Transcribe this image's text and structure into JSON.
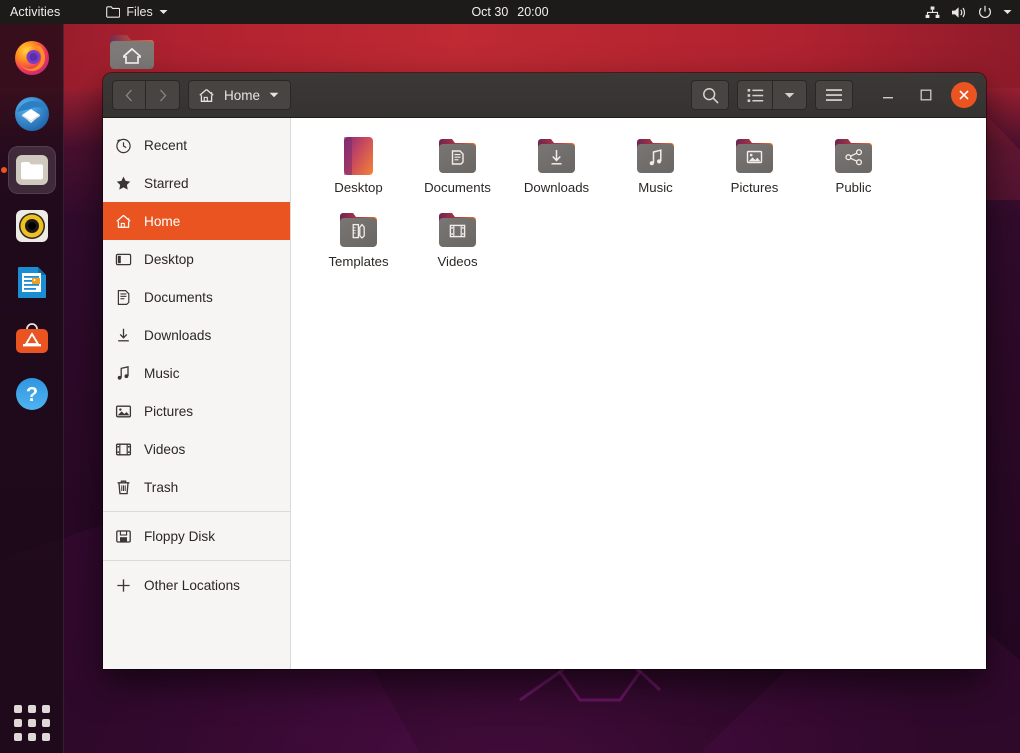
{
  "topbar": {
    "activities": "Activities",
    "app_name": "Files",
    "app_icon": "folder-icon",
    "app_menu_arrow_icon": "chevron-down-icon",
    "clock_date": "Oct 30",
    "clock_time": "20:00",
    "tray_icons": [
      "network-icon",
      "volume-icon",
      "power-icon",
      "chevron-down-icon"
    ]
  },
  "dock": {
    "items": [
      {
        "name": "firefox",
        "label": "Firefox",
        "active": false
      },
      {
        "name": "thunderbird",
        "label": "Thunderbird",
        "active": false
      },
      {
        "name": "files",
        "label": "Files",
        "active": true
      },
      {
        "name": "rhythmbox",
        "label": "Rhythmbox",
        "active": false
      },
      {
        "name": "libreoffice-writer",
        "label": "LibreOffice Writer",
        "active": false
      },
      {
        "name": "ubuntu-software",
        "label": "Ubuntu Software",
        "active": false
      },
      {
        "name": "help",
        "label": "Help",
        "active": false
      }
    ],
    "app_grid_label": "Show Applications"
  },
  "desktop": {
    "home_icon_label": ""
  },
  "window": {
    "header": {
      "back_icon": "chevron-left-icon",
      "forward_icon": "chevron-right-icon",
      "path_icon": "home-icon",
      "path_label": "Home",
      "path_arrow_icon": "chevron-down-icon",
      "search_icon": "search-icon",
      "view_list_icon": "list-view-icon",
      "view_arrow_icon": "chevron-down-icon",
      "menu_icon": "hamburger-menu-icon",
      "minimize_icon": "minimize-icon",
      "maximize_icon": "maximize-icon",
      "close_icon": "close-icon",
      "accent_color": "#e95420"
    },
    "sidebar": {
      "items": [
        {
          "label": "Recent",
          "icon": "clock-icon",
          "selected": false
        },
        {
          "label": "Starred",
          "icon": "star-icon",
          "selected": false
        },
        {
          "label": "Home",
          "icon": "home-icon",
          "selected": true
        },
        {
          "label": "Desktop",
          "icon": "desktop-icon",
          "selected": false
        },
        {
          "label": "Documents",
          "icon": "document-icon",
          "selected": false
        },
        {
          "label": "Downloads",
          "icon": "download-icon",
          "selected": false
        },
        {
          "label": "Music",
          "icon": "music-icon",
          "selected": false
        },
        {
          "label": "Pictures",
          "icon": "image-icon",
          "selected": false
        },
        {
          "label": "Videos",
          "icon": "video-icon",
          "selected": false
        },
        {
          "label": "Trash",
          "icon": "trash-icon",
          "selected": false
        },
        {
          "label": "Floppy Disk",
          "icon": "floppy-icon",
          "selected": false
        },
        {
          "label": "Other Locations",
          "icon": "plus-icon",
          "selected": false
        }
      ],
      "separator_after": [
        9,
        10
      ]
    },
    "files": [
      {
        "label": "Desktop",
        "icon": "wallpaper-thumb",
        "kind": "thumb"
      },
      {
        "label": "Documents",
        "icon": "folder-documents-icon",
        "kind": "folder"
      },
      {
        "label": "Downloads",
        "icon": "folder-downloads-icon",
        "kind": "folder"
      },
      {
        "label": "Music",
        "icon": "folder-music-icon",
        "kind": "folder"
      },
      {
        "label": "Pictures",
        "icon": "folder-pictures-icon",
        "kind": "folder"
      },
      {
        "label": "Public",
        "icon": "folder-public-icon",
        "kind": "folder"
      },
      {
        "label": "Templates",
        "icon": "folder-templates-icon",
        "kind": "folder"
      },
      {
        "label": "Videos",
        "icon": "folder-videos-icon",
        "kind": "folder"
      }
    ]
  }
}
